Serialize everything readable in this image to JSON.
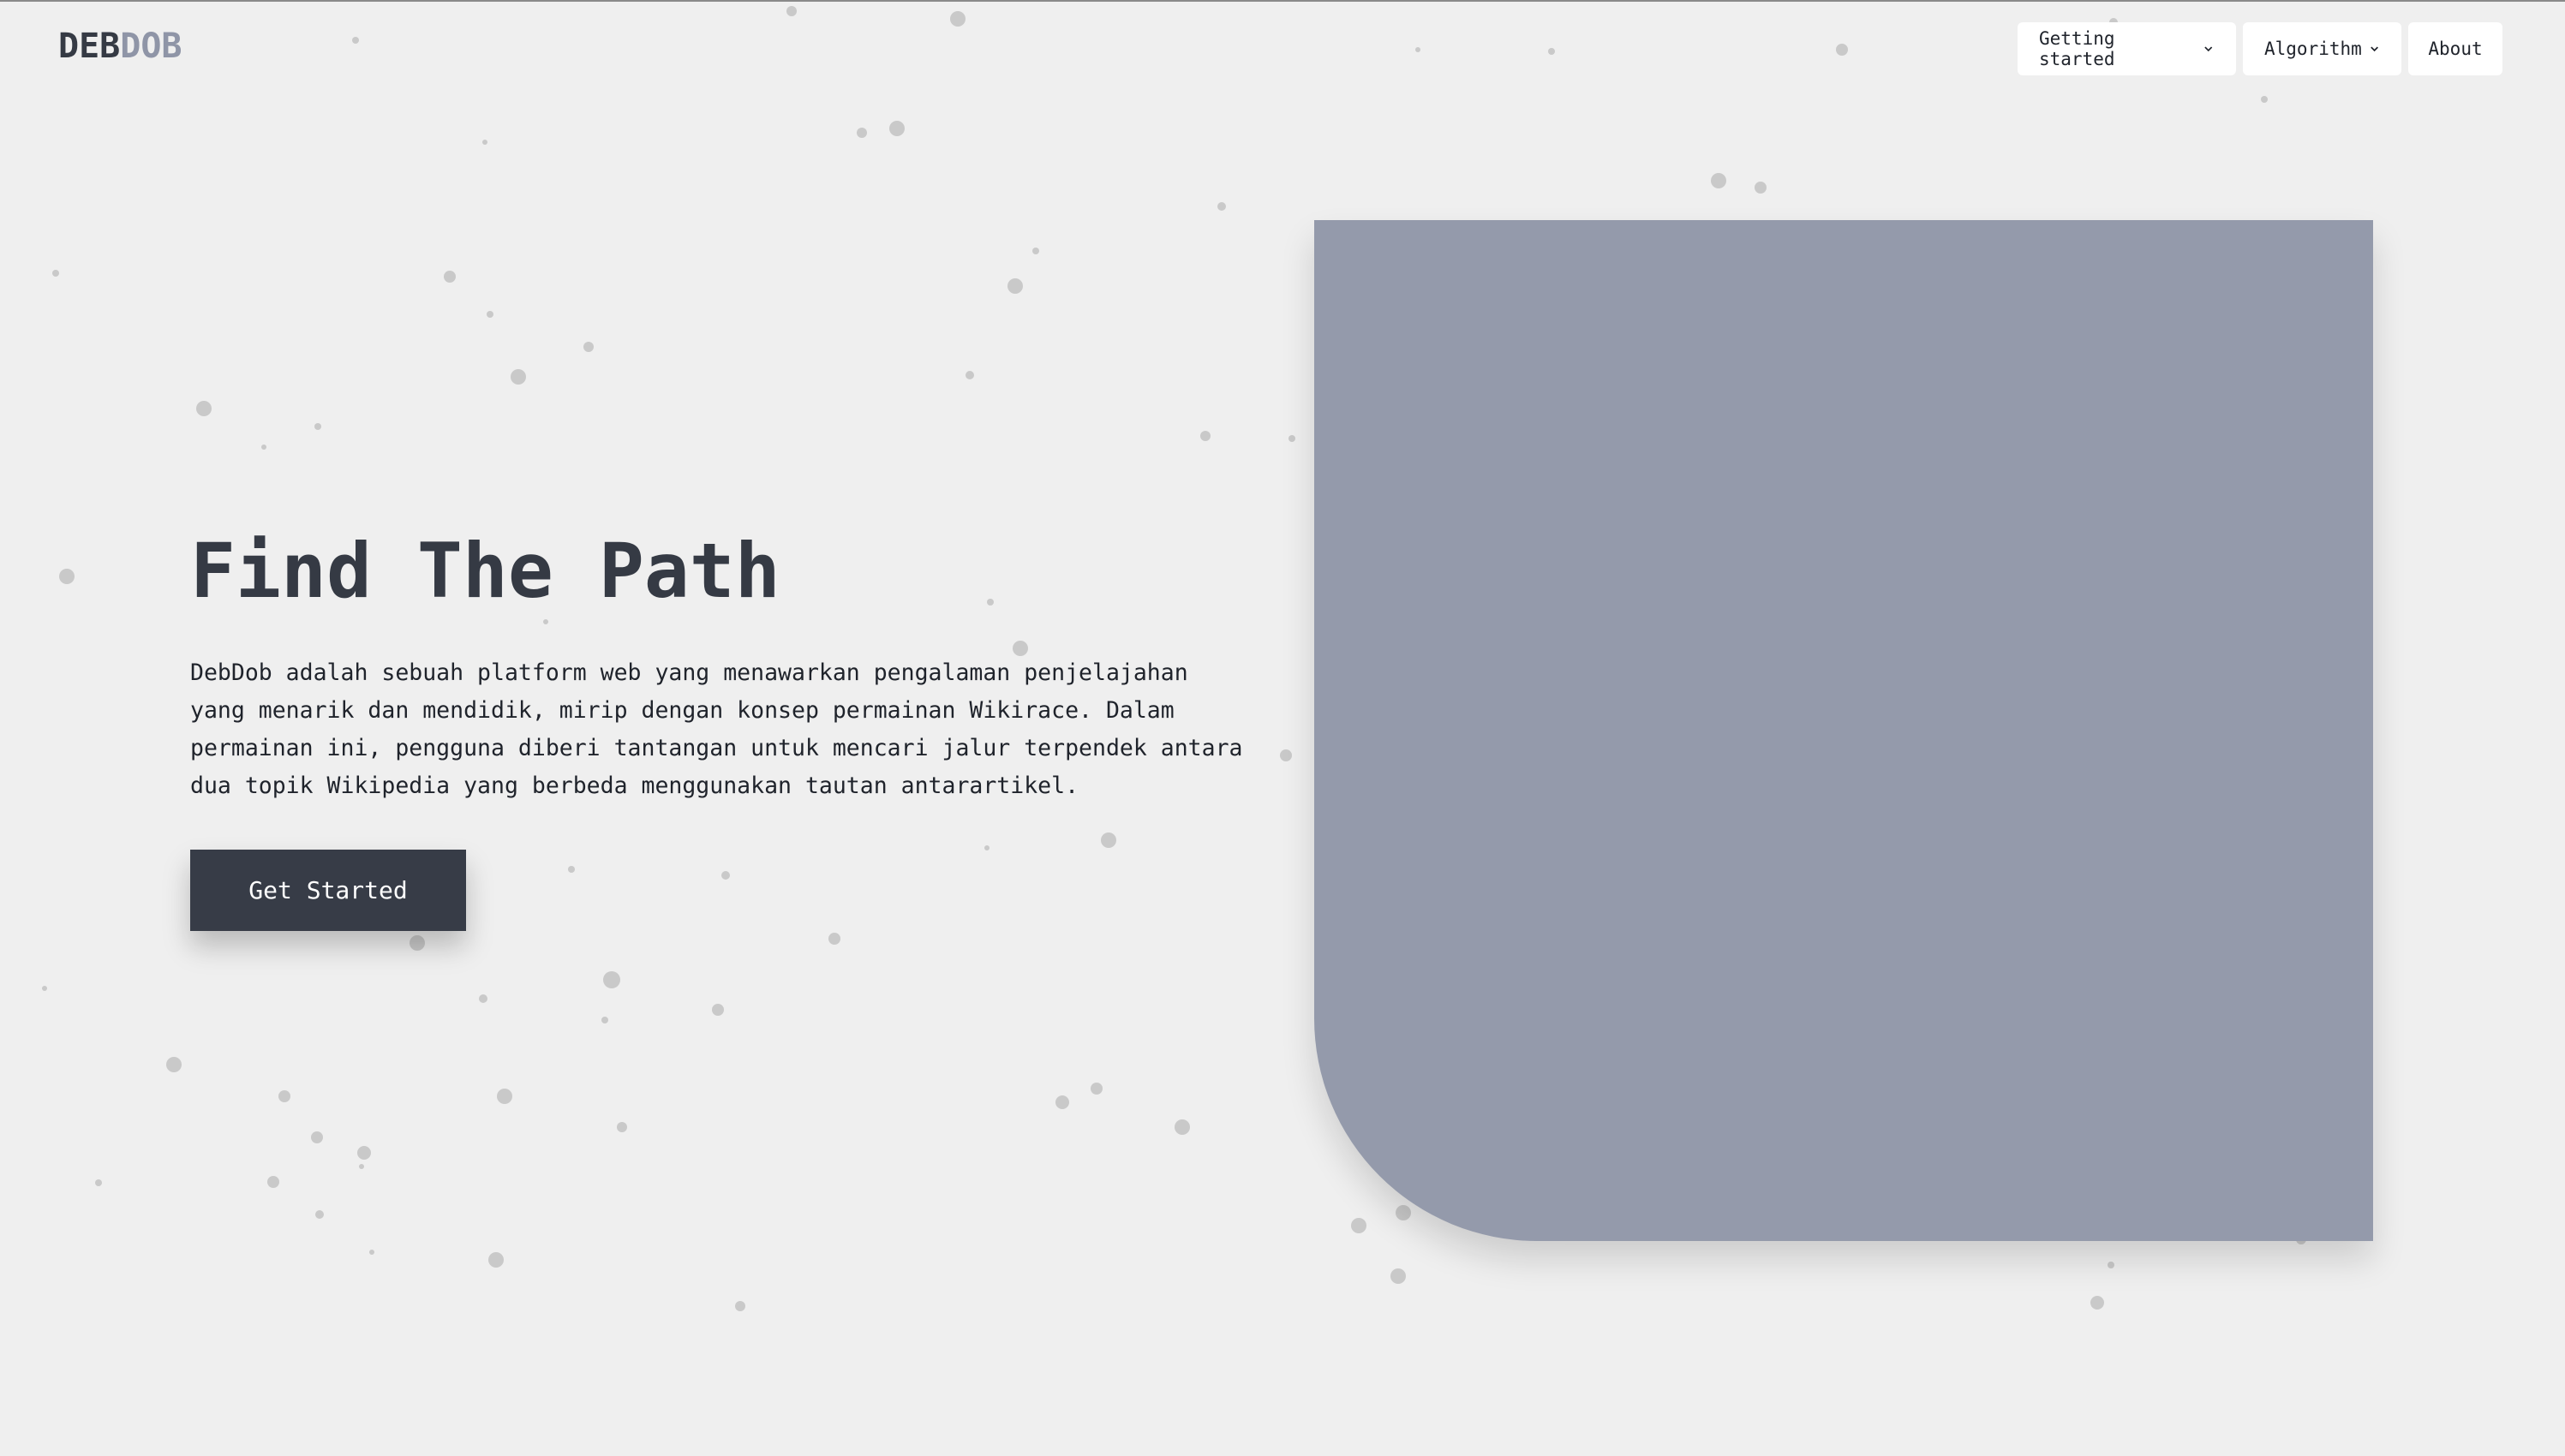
{
  "brand": {
    "part1": "DEB",
    "part2": "DOB"
  },
  "nav": {
    "getting_started": "Getting started",
    "algorithm": "Algorithm",
    "about": "About"
  },
  "hero": {
    "title": "Find The Path",
    "description": "DebDob adalah sebuah platform web yang menawarkan pengalaman penjelajahan yang menarik dan mendidik, mirip dengan konsep permainan Wikirace. Dalam permainan ini, pengguna diberi tantangan untuk mencari jalur terpendek antara dua topik Wikipedia yang berbeda menggunakan tautan antarartikel.",
    "cta_label": "Get Started"
  },
  "colors": {
    "background": "#efefef",
    "dark": "#353a44",
    "accent": "#8f95a7",
    "panel": "#949aab",
    "particle": "#c8c8c8"
  },
  "icons": {
    "dropdown": "chevron-down-icon"
  }
}
